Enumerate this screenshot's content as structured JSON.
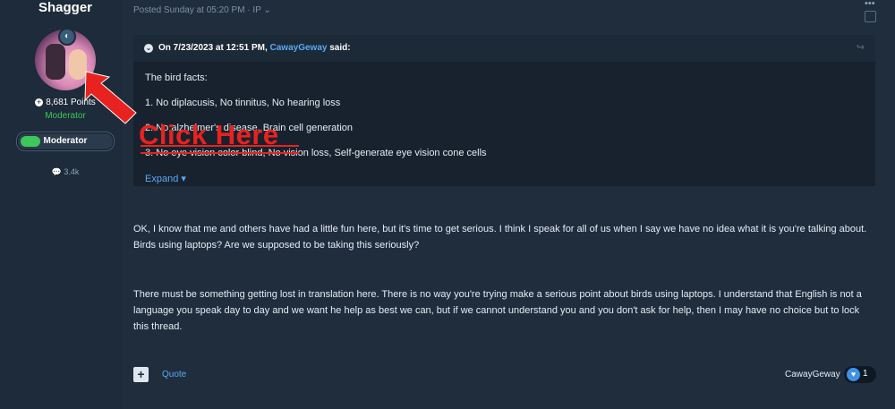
{
  "user": {
    "name": "Shagger",
    "points": "8,681 Points",
    "role": "Moderator",
    "badge": "Moderator",
    "reactions_count": "3.4k"
  },
  "post": {
    "meta": "Posted Sunday at 05:20 PM · IP",
    "quote": {
      "header_prefix": "On 7/23/2023 at 12:51 PM,",
      "author": "CawayGeway",
      "said": "said:",
      "lines": [
        "The bird facts:",
        "1. No diplacusis, No tinnitus, No hearing loss",
        "2. No alzheimer's disease, Brain cell generation",
        "3. No eye vision color blind, No vision loss, Self-generate eye vision cone cells"
      ],
      "expand_label": "Expand"
    },
    "paragraphs": [
      "OK, I know that me and others have had a little fun here, but it's time to get serious. I think I speak for all of us when I say we have no idea what it is you're talking about. Birds using laptops? Are we supposed to be taking this seriously?",
      "There must be something getting lost in translation here. There is no way you're trying make a serious point about birds using laptops. I understand that English is not a language you speak day to day and we want he help as best we can, but if we cannot understand you and you don't ask for help, then I may have no choice but to lock this thread."
    ],
    "footer": {
      "quote_label": "Quote",
      "reactor": "CawayGeway",
      "like_count": "1"
    }
  },
  "overlay": {
    "text": "Click Here",
    "color": "#e8221f"
  },
  "icons": [
    "plus-icon",
    "chat-icon",
    "heart-icon",
    "chevron-down-icon",
    "share-icon",
    "more-icon",
    "arrow-icon"
  ]
}
